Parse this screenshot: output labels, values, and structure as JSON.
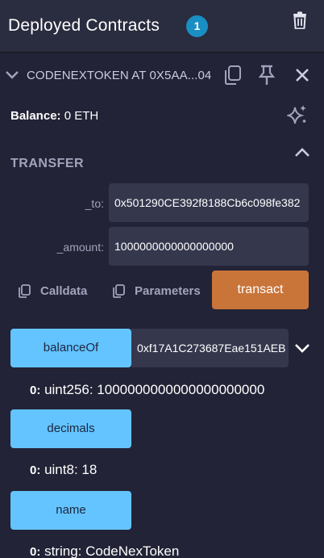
{
  "header": {
    "title": "Deployed Contracts",
    "count": "1"
  },
  "contract": {
    "name": "CODENEXTOKEN AT 0X5AA...04"
  },
  "balance": {
    "label": "Balance:",
    "value": "0 ETH"
  },
  "transfer": {
    "title": "TRANSFER",
    "fields": [
      {
        "label": "_to:",
        "value": "0x501290CE392f8188Cb6c098fe382"
      },
      {
        "label": "_amount:",
        "value": "1000000000000000000"
      }
    ],
    "calldata_label": "Calldata",
    "parameters_label": "Parameters",
    "transact_label": "transact"
  },
  "functions": [
    {
      "label": "balanceOf",
      "input": "0xf17A1C273687Eae151AEB",
      "result_index": "0:",
      "result": "uint256: 1000000000000000000000"
    },
    {
      "label": "decimals",
      "result_index": "0:",
      "result": "uint8: 18"
    },
    {
      "label": "name",
      "result_index": "0:",
      "result": "string: CodeNexToken"
    }
  ],
  "colors": {
    "background": "#222336",
    "header": "#2a2c3f",
    "function_button": "#64c4ff",
    "transact_button": "#c97539",
    "badge": "#1a8fc3"
  }
}
